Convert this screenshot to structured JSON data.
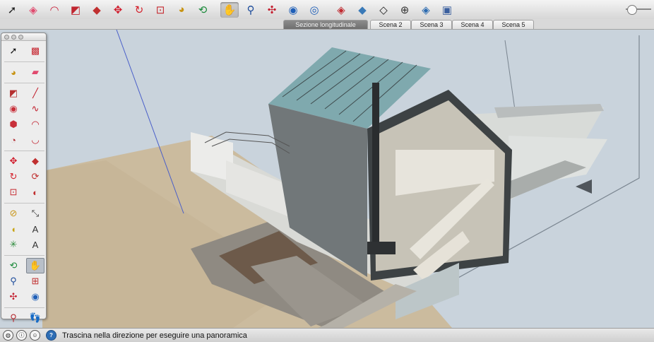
{
  "toolbar": {
    "buttons": [
      {
        "name": "select-icon",
        "glyph": "➚",
        "color": "#222"
      },
      {
        "name": "eraser-icon",
        "glyph": "◈",
        "color": "#e04a6e"
      },
      {
        "name": "arc-icon",
        "glyph": "◠",
        "color": "#c8203a"
      },
      {
        "name": "rectangle-icon",
        "glyph": "◩",
        "color": "#c02530"
      },
      {
        "name": "push-pull-icon",
        "glyph": "◆",
        "color": "#c03030"
      },
      {
        "name": "move-icon",
        "glyph": "✥",
        "color": "#d01c2c"
      },
      {
        "name": "rotate-icon",
        "glyph": "↻",
        "color": "#d4202a"
      },
      {
        "name": "scale-icon",
        "glyph": "⊡",
        "color": "#c62a30"
      },
      {
        "name": "paint-bucket-icon",
        "glyph": "◕",
        "color": "#c89414"
      },
      {
        "name": "orbit-icon",
        "glyph": "⟲",
        "color": "#1a8a3a"
      },
      {
        "name": "pan-icon",
        "glyph": "✋",
        "color": "#444",
        "active": true
      },
      {
        "name": "zoom-icon",
        "glyph": "⚲",
        "color": "#1a4a9a"
      },
      {
        "name": "zoom-extents-icon",
        "glyph": "✣",
        "color": "#c42030"
      },
      {
        "name": "previous-view-icon",
        "glyph": "◉",
        "color": "#1f5fb8"
      },
      {
        "name": "next-view-icon",
        "glyph": "◎",
        "color": "#1f5fb8"
      },
      {
        "name": "components-icon",
        "glyph": "◈",
        "color": "#c02a30"
      },
      {
        "name": "iso-view-icon",
        "glyph": "◆",
        "color": "#3a7ab8"
      },
      {
        "name": "top-view-icon",
        "glyph": "◇",
        "color": "#222"
      },
      {
        "name": "position-camera-icon",
        "glyph": "⊕",
        "color": "#333"
      },
      {
        "name": "walk-icon",
        "glyph": "◈",
        "color": "#2a6ab0"
      },
      {
        "name": "shadows-icon",
        "glyph": "▣",
        "color": "#3a5f9e"
      }
    ]
  },
  "scene_tabs": [
    {
      "label": "Sezione longitudinale",
      "active": true
    },
    {
      "label": "Scena 2",
      "active": false
    },
    {
      "label": "Scena 3",
      "active": false
    },
    {
      "label": "Scena 4",
      "active": false
    },
    {
      "label": "Scena 5",
      "active": false
    }
  ],
  "palette": {
    "groups": [
      [
        {
          "name": "select-tool-icon",
          "glyph": "➚",
          "color": "#111"
        },
        {
          "name": "make-component-icon",
          "glyph": "▩",
          "color": "#c72a34"
        }
      ],
      [
        {
          "name": "paint-bucket-tool-icon",
          "glyph": "◕",
          "color": "#c89414"
        },
        {
          "name": "eraser-tool-icon",
          "glyph": "▰",
          "color": "#e04a6e"
        }
      ],
      [
        {
          "name": "rectangle-tool-icon",
          "glyph": "◩",
          "color": "#b53030"
        },
        {
          "name": "line-tool-icon",
          "glyph": "╱",
          "color": "#c01a28"
        },
        {
          "name": "circle-tool-icon",
          "glyph": "◉",
          "color": "#c8303a"
        },
        {
          "name": "freehand-tool-icon",
          "glyph": "∿",
          "color": "#c01a28"
        },
        {
          "name": "polygon-tool-icon",
          "glyph": "⬢",
          "color": "#c8303a"
        },
        {
          "name": "arc-tool-icon",
          "glyph": "◠",
          "color": "#c01a28"
        },
        {
          "name": "pie-tool-icon",
          "glyph": "◔",
          "color": "#b02a30"
        },
        {
          "name": "three-point-arc-icon",
          "glyph": "◡",
          "color": "#c01a28"
        }
      ],
      [
        {
          "name": "move-tool-icon",
          "glyph": "✥",
          "color": "#d01c2c"
        },
        {
          "name": "push-pull-tool-icon",
          "glyph": "◆",
          "color": "#c03030"
        },
        {
          "name": "rotate-tool-icon",
          "glyph": "↻",
          "color": "#d4202a"
        },
        {
          "name": "follow-me-icon",
          "glyph": "⟳",
          "color": "#c03030"
        },
        {
          "name": "scale-tool-icon",
          "glyph": "⊡",
          "color": "#c62a30"
        },
        {
          "name": "offset-tool-icon",
          "glyph": "◐",
          "color": "#c03030"
        }
      ],
      [
        {
          "name": "tape-measure-icon",
          "glyph": "⊘",
          "color": "#c89414"
        },
        {
          "name": "dimension-icon",
          "glyph": "⤡",
          "color": "#333"
        },
        {
          "name": "protractor-icon",
          "glyph": "◖",
          "color": "#c8a414"
        },
        {
          "name": "text-tool-icon",
          "glyph": "A",
          "color": "#333"
        },
        {
          "name": "axes-tool-icon",
          "glyph": "✳",
          "color": "#2a8a3a"
        },
        {
          "name": "three-d-text-icon",
          "glyph": "A",
          "color": "#333"
        }
      ],
      [
        {
          "name": "orbit-tool-icon",
          "glyph": "⟲",
          "color": "#1a8a3a"
        },
        {
          "name": "pan-tool-icon",
          "glyph": "✋",
          "color": "#333",
          "selected": true
        },
        {
          "name": "zoom-tool-icon",
          "glyph": "⚲",
          "color": "#1a4a9a"
        },
        {
          "name": "zoom-window-icon",
          "glyph": "⊞",
          "color": "#c03030"
        },
        {
          "name": "zoom-extents-tool-icon",
          "glyph": "✣",
          "color": "#c42030"
        },
        {
          "name": "previous-tool-icon",
          "glyph": "◉",
          "color": "#1f5fb8"
        }
      ],
      [
        {
          "name": "position-camera-tool-icon",
          "glyph": "⚲",
          "color": "#b52a30"
        },
        {
          "name": "walk-tool-icon",
          "glyph": "👣",
          "color": "#222"
        },
        {
          "name": "look-around-icon",
          "glyph": "◉",
          "color": "#333"
        },
        {
          "name": "section-plane-icon",
          "glyph": "⊕",
          "color": "#333"
        }
      ]
    ]
  },
  "status": {
    "message": "Trascina nella direzione per eseguire una panoramica",
    "help_glyph": "?"
  },
  "scene": {
    "sky_color": "#c9d3dc",
    "ground_color": "#cbbb9e",
    "section_arrow_color": "#50565c"
  }
}
